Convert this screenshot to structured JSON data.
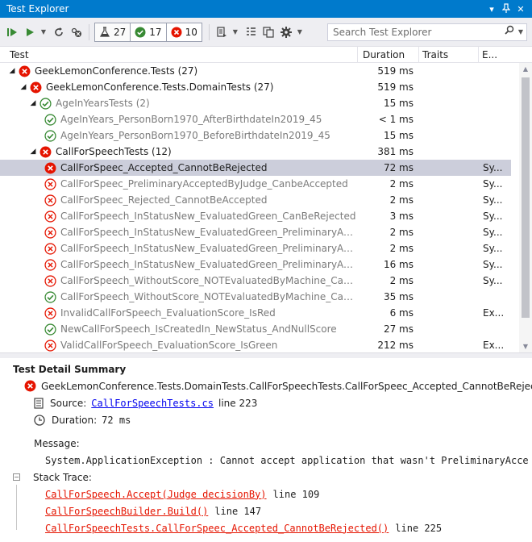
{
  "window": {
    "title": "Test Explorer"
  },
  "toolbar": {
    "counters": {
      "total": "27",
      "passed": "17",
      "failed": "10"
    },
    "search_placeholder": "Search Test Explorer"
  },
  "columns": {
    "test": "Test",
    "duration": "Duration",
    "traits": "Traits",
    "error": "E..."
  },
  "tree": [
    {
      "name": "GeekLemonConference.Tests (27)",
      "duration": "519 ms",
      "traits": "",
      "err": "",
      "status": "fail",
      "level": 0,
      "expanded": true,
      "dim": false
    },
    {
      "name": "GeekLemonConference.Tests.DomainTests (27)",
      "duration": "519 ms",
      "traits": "",
      "err": "",
      "status": "fail",
      "level": 1,
      "expanded": true,
      "dim": false
    },
    {
      "name": "AgeInYearsTests (2)",
      "duration": "15 ms",
      "traits": "",
      "err": "",
      "status": "pass",
      "level": 2,
      "expanded": true,
      "dim": true
    },
    {
      "name": "AgeInYears_PersonBorn1970_AfterBirthdateIn2019_45",
      "duration": "< 1 ms",
      "traits": "",
      "err": "",
      "status": "pass",
      "level": 3,
      "dim": true
    },
    {
      "name": "AgeInYears_PersonBorn1970_BeforeBirthdateIn2019_45",
      "duration": "15 ms",
      "traits": "",
      "err": "",
      "status": "pass",
      "level": 3,
      "dim": true
    },
    {
      "name": "CallForSpeechTests (12)",
      "duration": "381 ms",
      "traits": "",
      "err": "",
      "status": "fail",
      "level": 2,
      "expanded": true,
      "dim": false
    },
    {
      "name": "CallForSpeec_Accepted_CannotBeRejected",
      "duration": "72 ms",
      "traits": "",
      "err": "Sy...",
      "status": "fail",
      "level": 3,
      "dim": false,
      "selected": true
    },
    {
      "name": "CallForSpeec_PreliminaryAcceptedByJudge_CanbeAccepted",
      "duration": "2 ms",
      "traits": "",
      "err": "Sy...",
      "status": "fail",
      "level": 3,
      "dim": true
    },
    {
      "name": "CallForSpeec_Rejected_CannotBeAccepted",
      "duration": "2 ms",
      "traits": "",
      "err": "Sy...",
      "status": "fail",
      "level": 3,
      "dim": true
    },
    {
      "name": "CallForSpeech_InStatusNew_EvaluatedGreen_CanBeRejected",
      "duration": "3 ms",
      "traits": "",
      "err": "Sy...",
      "status": "fail",
      "level": 3,
      "dim": true
    },
    {
      "name": "CallForSpeech_InStatusNew_EvaluatedGreen_PreliminaryAccept_The...",
      "duration": "2 ms",
      "traits": "",
      "err": "Sy...",
      "status": "fail",
      "level": 3,
      "dim": true
    },
    {
      "name": "CallForSpeech_InStatusNew_EvaluatedGreen_PreliminaryAccepted_...",
      "duration": "2 ms",
      "traits": "",
      "err": "Sy...",
      "status": "fail",
      "level": 3,
      "dim": true
    },
    {
      "name": "CallForSpeech_InStatusNew_EvaluatedGreen_PreliminaryAccepted_T...",
      "duration": "16 ms",
      "traits": "",
      "err": "Sy...",
      "status": "fail",
      "level": 3,
      "dim": true
    },
    {
      "name": "CallForSpeech_WithoutScore_NOTEvaluatedByMachine_CanBeRejec...",
      "duration": "2 ms",
      "traits": "",
      "err": "Sy...",
      "status": "fail",
      "level": 3,
      "dim": true
    },
    {
      "name": "CallForSpeech_WithoutScore_NOTEvaluatedByMachine_CannotBePr...",
      "duration": "35 ms",
      "traits": "",
      "err": "",
      "status": "pass",
      "level": 3,
      "dim": true
    },
    {
      "name": "InvalidCallForSpeech_EvaluationScore_IsRed",
      "duration": "6 ms",
      "traits": "",
      "err": "Ex...",
      "status": "fail",
      "level": 3,
      "dim": true
    },
    {
      "name": "NewCallForSpeech_IsCreatedIn_NewStatus_AndNullScore",
      "duration": "27 ms",
      "traits": "",
      "err": "",
      "status": "pass",
      "level": 3,
      "dim": true
    },
    {
      "name": "ValidCallForSpeech_EvaluationScore_IsGreen",
      "duration": "212 ms",
      "traits": "",
      "err": "Ex...",
      "status": "fail",
      "level": 3,
      "dim": true
    }
  ],
  "detail": {
    "heading": "Test Detail Summary",
    "test_name": "GeekLemonConference.Tests.DomainTests.CallForSpeechTests.CallForSpeec_Accepted_CannotBeRejected",
    "source_label": "Source:",
    "source_file": "CallForSpeechTests.cs",
    "source_line": "line 223",
    "duration_label": "Duration:",
    "duration_value": "72 ms",
    "message_label": "Message:",
    "message_text": "System.ApplicationException : Cannot accept application that wasn't PreliminaryAcce",
    "stack_label": "Stack Trace:",
    "stack": [
      {
        "method": "CallForSpeech.Accept(Judge decisionBy)",
        "line": "line 109"
      },
      {
        "method": "CallForSpeechBuilder.Build()",
        "line": "line 147"
      },
      {
        "method": "CallForSpeechTests.CallForSpeec_Accepted_CannotBeRejected()",
        "line": "line 225"
      }
    ]
  },
  "colors": {
    "accent": "#007acc",
    "fail": "#e51400",
    "pass": "#388a34",
    "selected_row": "#cccedb"
  }
}
